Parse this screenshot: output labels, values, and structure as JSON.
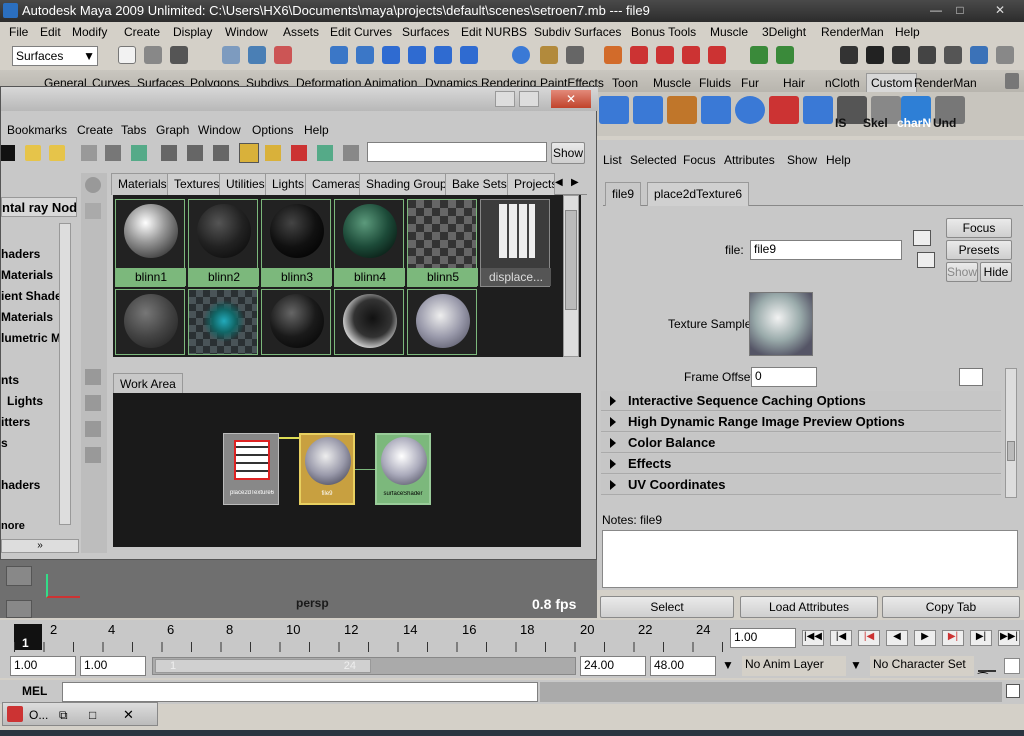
{
  "window": {
    "title": "Autodesk Maya 2009 Unlimited: C:\\Users\\HX6\\Documents\\maya\\projects\\default\\scenes\\setroen7.mb   ---   file9"
  },
  "menubar": [
    "File",
    "Edit",
    "Modify",
    "Create",
    "Display",
    "Window",
    "Assets",
    "Edit Curves",
    "Surfaces",
    "Edit NURBS",
    "Subdiv Surfaces",
    "Bonus Tools",
    "Muscle",
    "3Delight",
    "RenderMan",
    "Help"
  ],
  "statusline": {
    "mode": "Surfaces"
  },
  "shelf_tabs": [
    "General",
    "Curves",
    "Surfaces",
    "Polygons",
    "Subdivs",
    "Deformation",
    "Animation",
    "Dynamics",
    "Rendering",
    "PaintEffects",
    "Toon",
    "Muscle",
    "Fluids",
    "Fur",
    "Hair",
    "nCloth",
    "Custom",
    "RenderMan"
  ],
  "shelf_labels": [
    "IS",
    "Skel",
    "charN",
    "Und"
  ],
  "hypershade": {
    "menu": [
      "Bookmarks",
      "Create",
      "Tabs",
      "Graph",
      "Window",
      "Options",
      "Help"
    ],
    "show_label": "Show",
    "left_header": "ntal ray Nodes",
    "left_items": [
      "haders",
      "Materials",
      "ient Shade",
      "Materials",
      "lumetric M",
      "nts",
      "Lights",
      "itters",
      "s",
      "haders",
      "nore"
    ],
    "tabs": [
      "Materials",
      "Textures",
      "Utilities",
      "Lights",
      "Cameras",
      "Shading Groups",
      "Bake Sets",
      "Projects"
    ],
    "swatches": [
      "blinn1",
      "blinn2",
      "blinn3",
      "blinn4",
      "blinn5",
      "displace..."
    ],
    "work_area_tab": "Work Area",
    "nodes": [
      "place2dTexture6",
      "file9",
      "surfaceShader"
    ]
  },
  "attribute_editor": {
    "menu": [
      "List",
      "Selected",
      "Focus",
      "Attributes",
      "Show",
      "Help"
    ],
    "tabs": [
      "file9",
      "place2dTexture6"
    ],
    "file_label": "file:",
    "file_value": "file9",
    "buttons": {
      "focus": "Focus",
      "presets": "Presets",
      "show": "Show",
      "hide": "Hide"
    },
    "texture_sample_label": "Texture Sample",
    "frame_offset_label": "Frame Offset",
    "frame_offset_value": "0",
    "sections": [
      "Interactive Sequence Caching Options",
      "High Dynamic Range Image Preview Options",
      "Color Balance",
      "Effects",
      "UV Coordinates"
    ],
    "notes_label": "Notes:  file9",
    "bottom_buttons": [
      "Select",
      "Load Attributes",
      "Copy Tab"
    ]
  },
  "viewport": {
    "camera": "persp",
    "fps": "0.8 fps"
  },
  "timeline": {
    "ticks": [
      "1",
      "2",
      "4",
      "6",
      "8",
      "10",
      "12",
      "14",
      "16",
      "18",
      "20",
      "22",
      "24"
    ],
    "current": "1.00"
  },
  "range": {
    "start": "1.00",
    "start2": "1.00",
    "end": "24.00",
    "end2": "48.00",
    "slider_start": "1",
    "slider_end": "24",
    "anim_layer": "No Anim Layer",
    "char_set": "No Character Set"
  },
  "cmdline": {
    "label": "MEL"
  },
  "taskbar": {
    "item": "O..."
  }
}
